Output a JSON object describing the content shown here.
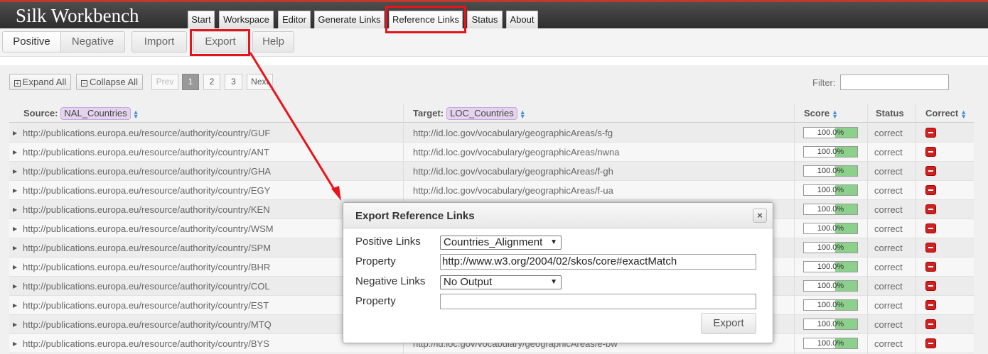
{
  "app": {
    "title": "Silk Workbench"
  },
  "nav": {
    "tabs": [
      "Start",
      "Workspace",
      "Editor",
      "Generate Links",
      "Reference Links",
      "Status",
      "About"
    ]
  },
  "subbar": {
    "positive": "Positive",
    "negative": "Negative",
    "import": "Import",
    "export": "Export",
    "help": "Help"
  },
  "toolbar": {
    "expand_all": "Expand All",
    "collapse_all": "Collapse All",
    "prev": "Prev",
    "pages": [
      "1",
      "2",
      "3"
    ],
    "next": "Next",
    "filter_label": "Filter:"
  },
  "table": {
    "source_label": "Source:",
    "source_tag": "NAL_Countries",
    "target_label": "Target:",
    "target_tag": "LOC_Countries",
    "score_label": "Score",
    "status_label": "Status",
    "correct_label": "Correct",
    "rows": [
      {
        "source": "http://publications.europa.eu/resource/authority/country/GUF",
        "target": "http://id.loc.gov/vocabulary/geographicAreas/s-fg",
        "score": "100.0%",
        "status": "correct"
      },
      {
        "source": "http://publications.europa.eu/resource/authority/country/ANT",
        "target": "http://id.loc.gov/vocabulary/geographicAreas/nwna",
        "score": "100.0%",
        "status": "correct"
      },
      {
        "source": "http://publications.europa.eu/resource/authority/country/GHA",
        "target": "http://id.loc.gov/vocabulary/geographicAreas/f-gh",
        "score": "100.0%",
        "status": "correct"
      },
      {
        "source": "http://publications.europa.eu/resource/authority/country/EGY",
        "target": "http://id.loc.gov/vocabulary/geographicAreas/f-ua",
        "score": "100.0%",
        "status": "correct"
      },
      {
        "source": "http://publications.europa.eu/resource/authority/country/KEN",
        "target": "",
        "score": "100.0%",
        "status": "correct"
      },
      {
        "source": "http://publications.europa.eu/resource/authority/country/WSM",
        "target": "",
        "score": "100.0%",
        "status": "correct"
      },
      {
        "source": "http://publications.europa.eu/resource/authority/country/SPM",
        "target": "",
        "score": "100.0%",
        "status": "correct"
      },
      {
        "source": "http://publications.europa.eu/resource/authority/country/BHR",
        "target": "",
        "score": "100.0%",
        "status": "correct"
      },
      {
        "source": "http://publications.europa.eu/resource/authority/country/COL",
        "target": "",
        "score": "100.0%",
        "status": "correct"
      },
      {
        "source": "http://publications.europa.eu/resource/authority/country/EST",
        "target": "",
        "score": "100.0%",
        "status": "correct"
      },
      {
        "source": "http://publications.europa.eu/resource/authority/country/MTQ",
        "target": "",
        "score": "100.0%",
        "status": "correct"
      },
      {
        "source": "http://publications.europa.eu/resource/authority/country/BYS",
        "target": "http://id.loc.gov/vocabulary/geographicAreas/e-bw",
        "score": "100.0%",
        "status": "correct"
      }
    ]
  },
  "dialog": {
    "title": "Export Reference Links",
    "close": "×",
    "positive_links_label": "Positive Links",
    "positive_links_value": "Countries_Alignment",
    "property_label": "Property",
    "property_value": "http://www.w3.org/2004/02/skos/core#exactMatch",
    "negative_links_label": "Negative Links",
    "negative_links_value": "No Output",
    "property2_label": "Property",
    "property2_value": "",
    "export_button": "Export"
  },
  "colors": {
    "highlight": "#e8141c",
    "score_fill": "#8bd08b",
    "remove": "#cc2222",
    "tag": "#e3d3ee"
  }
}
